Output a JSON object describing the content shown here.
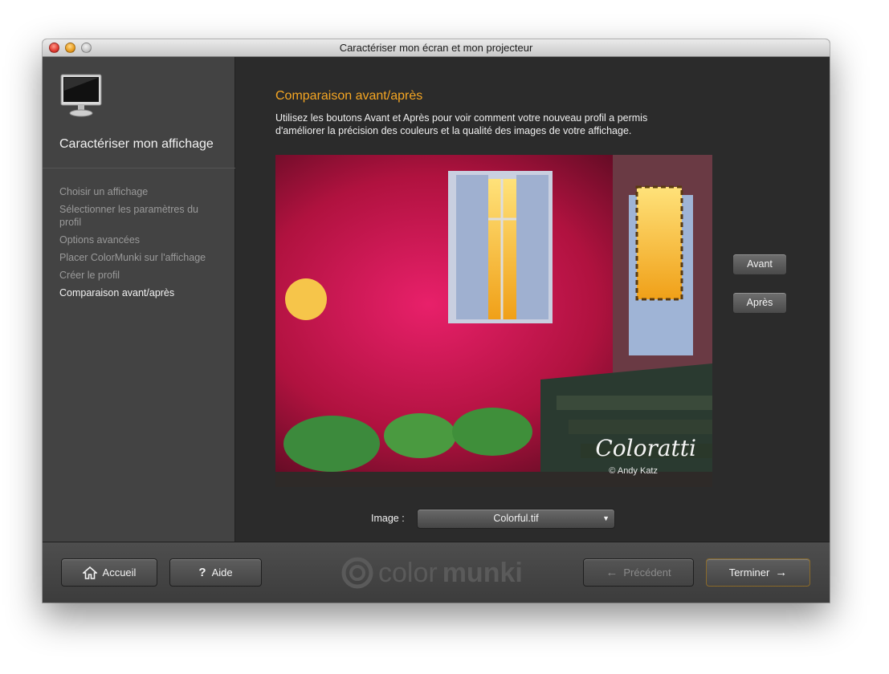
{
  "window": {
    "title": "Caractériser mon écran et mon projecteur"
  },
  "sidebar": {
    "title": "Caractériser mon affichage",
    "steps": [
      {
        "label": "Choisir un affichage"
      },
      {
        "label": "Sélectionner les paramètres du profil"
      },
      {
        "label": "Options avancées"
      },
      {
        "label": "Placer ColorMunki sur l'affichage"
      },
      {
        "label": "Créer le profil"
      },
      {
        "label": "Comparaison avant/après",
        "active": true
      }
    ]
  },
  "main": {
    "heading": "Comparaison avant/après",
    "description": "Utilisez les boutons Avant et Après pour voir comment votre nouveau profil a permis d'améliorer la précision des couleurs et la qualité des images de votre affichage.",
    "photo": {
      "watermark": "Coloratti",
      "credit": "© Andy Katz"
    },
    "before_button": "Avant",
    "after_button": "Après",
    "image_label": "Image :",
    "image_select": "Colorful.tif"
  },
  "footer": {
    "home_button": "Accueil",
    "help_button": "Aide",
    "prev_button": "Précédent",
    "finish_button": "Terminer",
    "brand_light": "color",
    "brand_bold": "munki"
  },
  "colors": {
    "accent_heading": "#f5a623",
    "sidebar_bg": "#434343",
    "main_bg": "#2b2b2b"
  }
}
